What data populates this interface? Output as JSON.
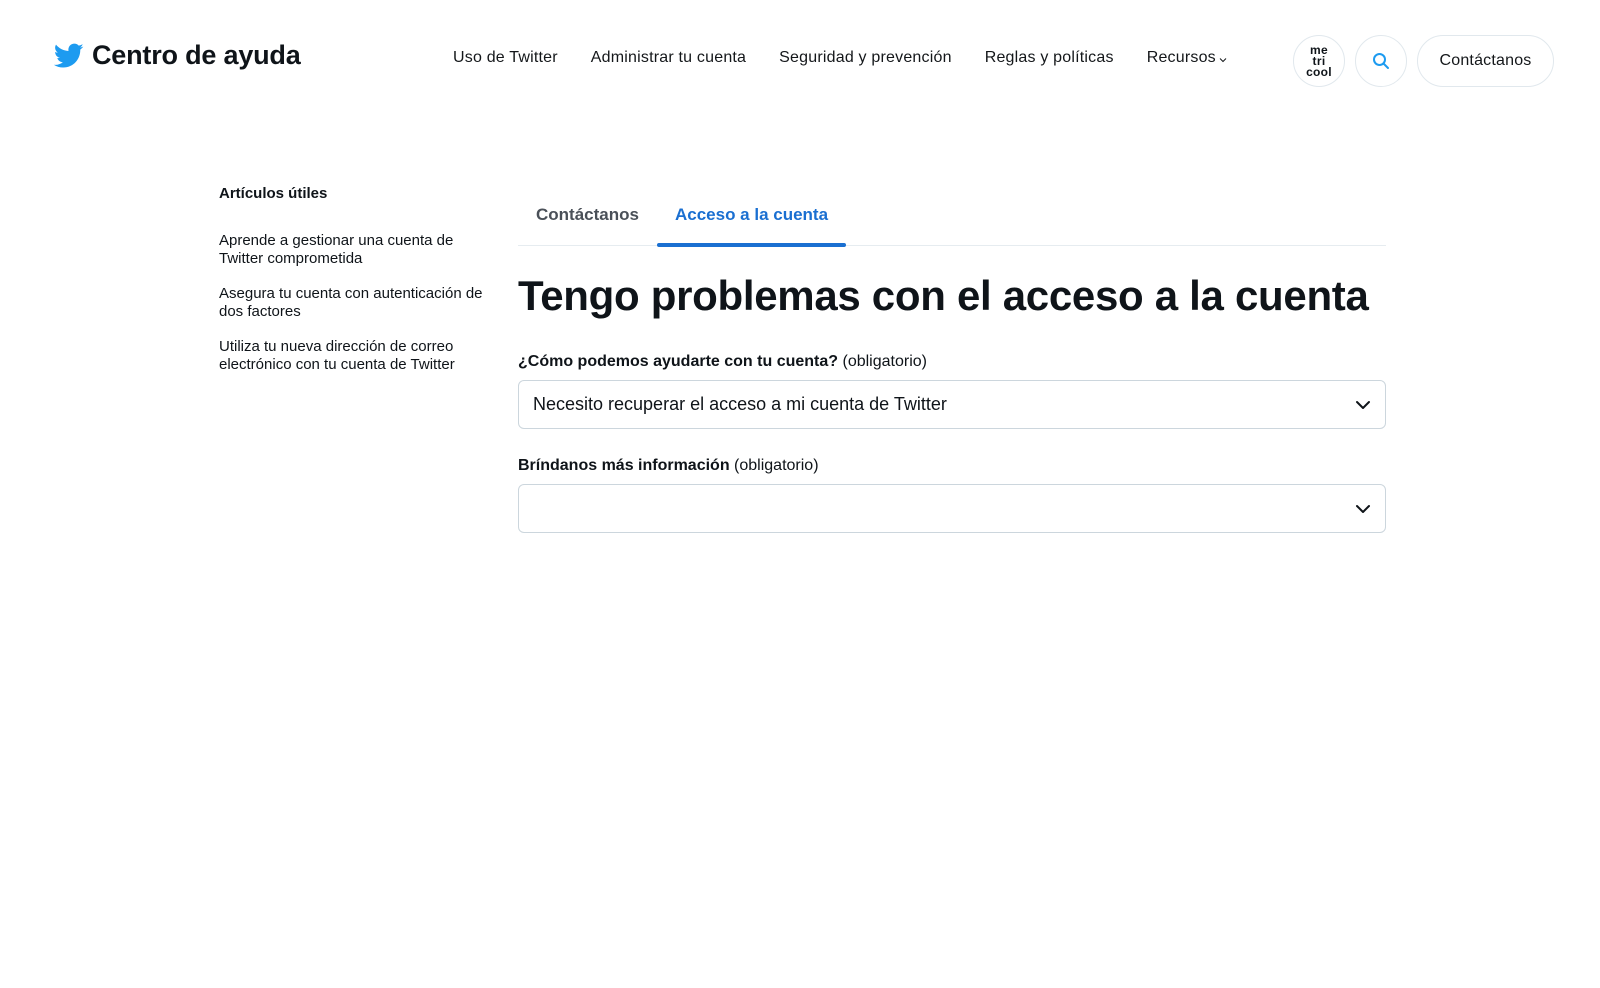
{
  "header": {
    "brand_title": "Centro de ayuda",
    "nav": [
      {
        "label": "Uso de Twitter"
      },
      {
        "label": "Administrar tu cuenta"
      },
      {
        "label": "Seguridad y prevención"
      },
      {
        "label": "Reglas y políticas"
      },
      {
        "label": "Recursos"
      }
    ],
    "avatar_text": "me\ntri\ncool",
    "contact_label": "Contáctanos"
  },
  "sidebar": {
    "title": "Artículos útiles",
    "links": [
      {
        "label": "Aprende a gestionar una cuenta de Twitter comprometida"
      },
      {
        "label": "Asegura tu cuenta con autenticación de dos factores"
      },
      {
        "label": "Utiliza tu nueva dirección de correo electrónico con tu cuenta de Twitter"
      }
    ]
  },
  "main": {
    "tabs": [
      {
        "label": "Contáctanos",
        "active": false
      },
      {
        "label": "Acceso a la cuenta",
        "active": true
      }
    ],
    "title": "Tengo problemas con el acceso a la cuenta",
    "fields": [
      {
        "label": "¿Cómo podemos ayudarte con tu cuenta?",
        "required_text": "(obligatorio)",
        "value": "Necesito recuperar el acceso a mi cuenta de Twitter"
      },
      {
        "label": "Bríndanos más información",
        "required_text": "(obligatorio)",
        "value": ""
      }
    ]
  },
  "colors": {
    "twitter_blue": "#1d9bf0",
    "active_tab": "#1a6fd1",
    "border": "#ccd6dd"
  }
}
